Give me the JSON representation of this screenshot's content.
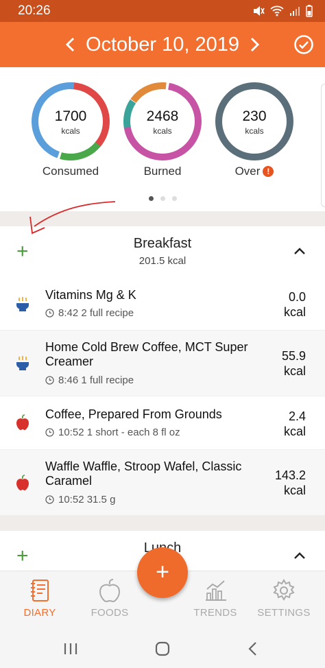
{
  "status_bar": {
    "time": "20:26"
  },
  "header": {
    "date": "October 10, 2019"
  },
  "summary": {
    "rings": [
      {
        "value": "1700",
        "unit": "kcals",
        "label": "Consumed"
      },
      {
        "value": "2468",
        "unit": "kcals",
        "label": "Burned"
      },
      {
        "value": "230",
        "unit": "kcals",
        "label": "Over"
      }
    ],
    "over_warning": "!",
    "page_dots": {
      "count": 3,
      "active": 1
    }
  },
  "meals": [
    {
      "title": "Breakfast",
      "total": "201.5 kcal",
      "entries": [
        {
          "name": "Vitamins Mg & K",
          "meta": "8:42 2 full recipe",
          "kcal": "0.0",
          "unit": "kcal",
          "icon": "recipe-bowl-icon"
        },
        {
          "name": "Home Cold Brew Coffee, MCT Super Creamer",
          "meta": "8:46 1 full recipe",
          "kcal": "55.9",
          "unit": "kcal",
          "icon": "recipe-bowl-icon"
        },
        {
          "name": "Coffee, Prepared From Grounds",
          "meta": "10:52 1 short - each 8 fl oz",
          "kcal": "2.4",
          "unit": "kcal",
          "icon": "apple-icon"
        },
        {
          "name": "Waffle Waffle, Stroop Wafel, Classic Caramel",
          "meta": "10:52 31.5 g",
          "kcal": "143.2",
          "unit": "kcal",
          "icon": "apple-icon"
        }
      ]
    },
    {
      "title": "Lunch"
    }
  ],
  "tabs": [
    {
      "label": "DIARY",
      "icon": "diary-icon",
      "active": true
    },
    {
      "label": "FOODS",
      "icon": "apple-outline-icon"
    },
    {
      "label": "TRENDS",
      "icon": "trends-icon"
    },
    {
      "label": "SETTINGS",
      "icon": "gear-icon"
    }
  ],
  "fab": {
    "symbol": "+"
  },
  "colors": {
    "brand": "#f26f2f",
    "consumed_ring": [
      "#e04848",
      "#4aa84a",
      "#5a9fdc"
    ],
    "burned_ring": [
      "#c653a3",
      "#e08a3a",
      "#3aa39a"
    ],
    "over_ring": "#5a6f7a",
    "add": "#4a9d3a"
  }
}
